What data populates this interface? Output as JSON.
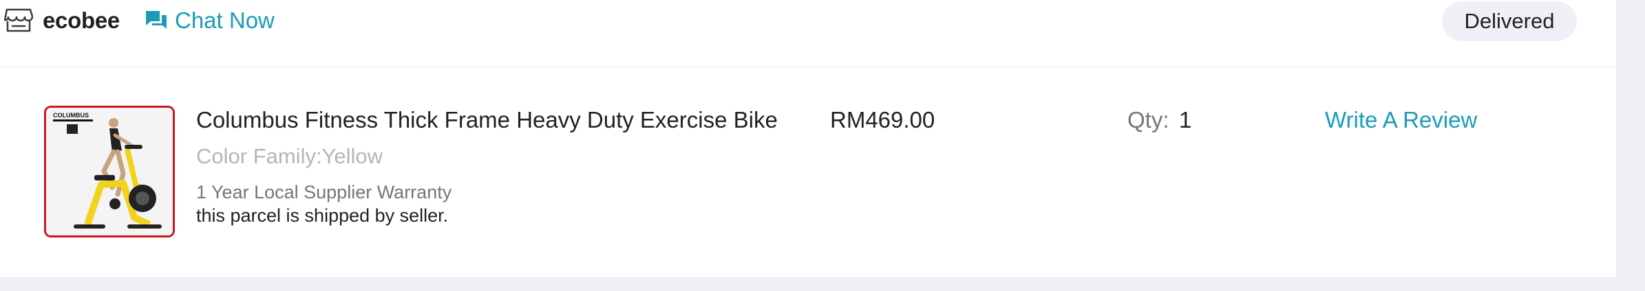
{
  "store": {
    "icon": "store-icon",
    "name": "ecobee",
    "chat_icon": "chat-bubbles-icon",
    "chat_label": "Chat Now"
  },
  "order": {
    "status": "Delivered"
  },
  "item": {
    "image_label": "COLUMBUS",
    "title": "Columbus Fitness Thick Frame Heavy Duty Exercise Bike",
    "variant": "Color Family:Yellow",
    "warranty": "1 Year Local Supplier Warranty",
    "shipping_note": "this parcel is shipped by seller.",
    "price": "RM469.00",
    "qty_label": "Qty:",
    "qty_value": "1",
    "review_label": "Write A Review"
  },
  "colors": {
    "accent": "#1a9cb7",
    "thumb_border": "#c8171e",
    "badge_bg": "#eff0f5",
    "bike_yellow": "#f2d21b"
  }
}
